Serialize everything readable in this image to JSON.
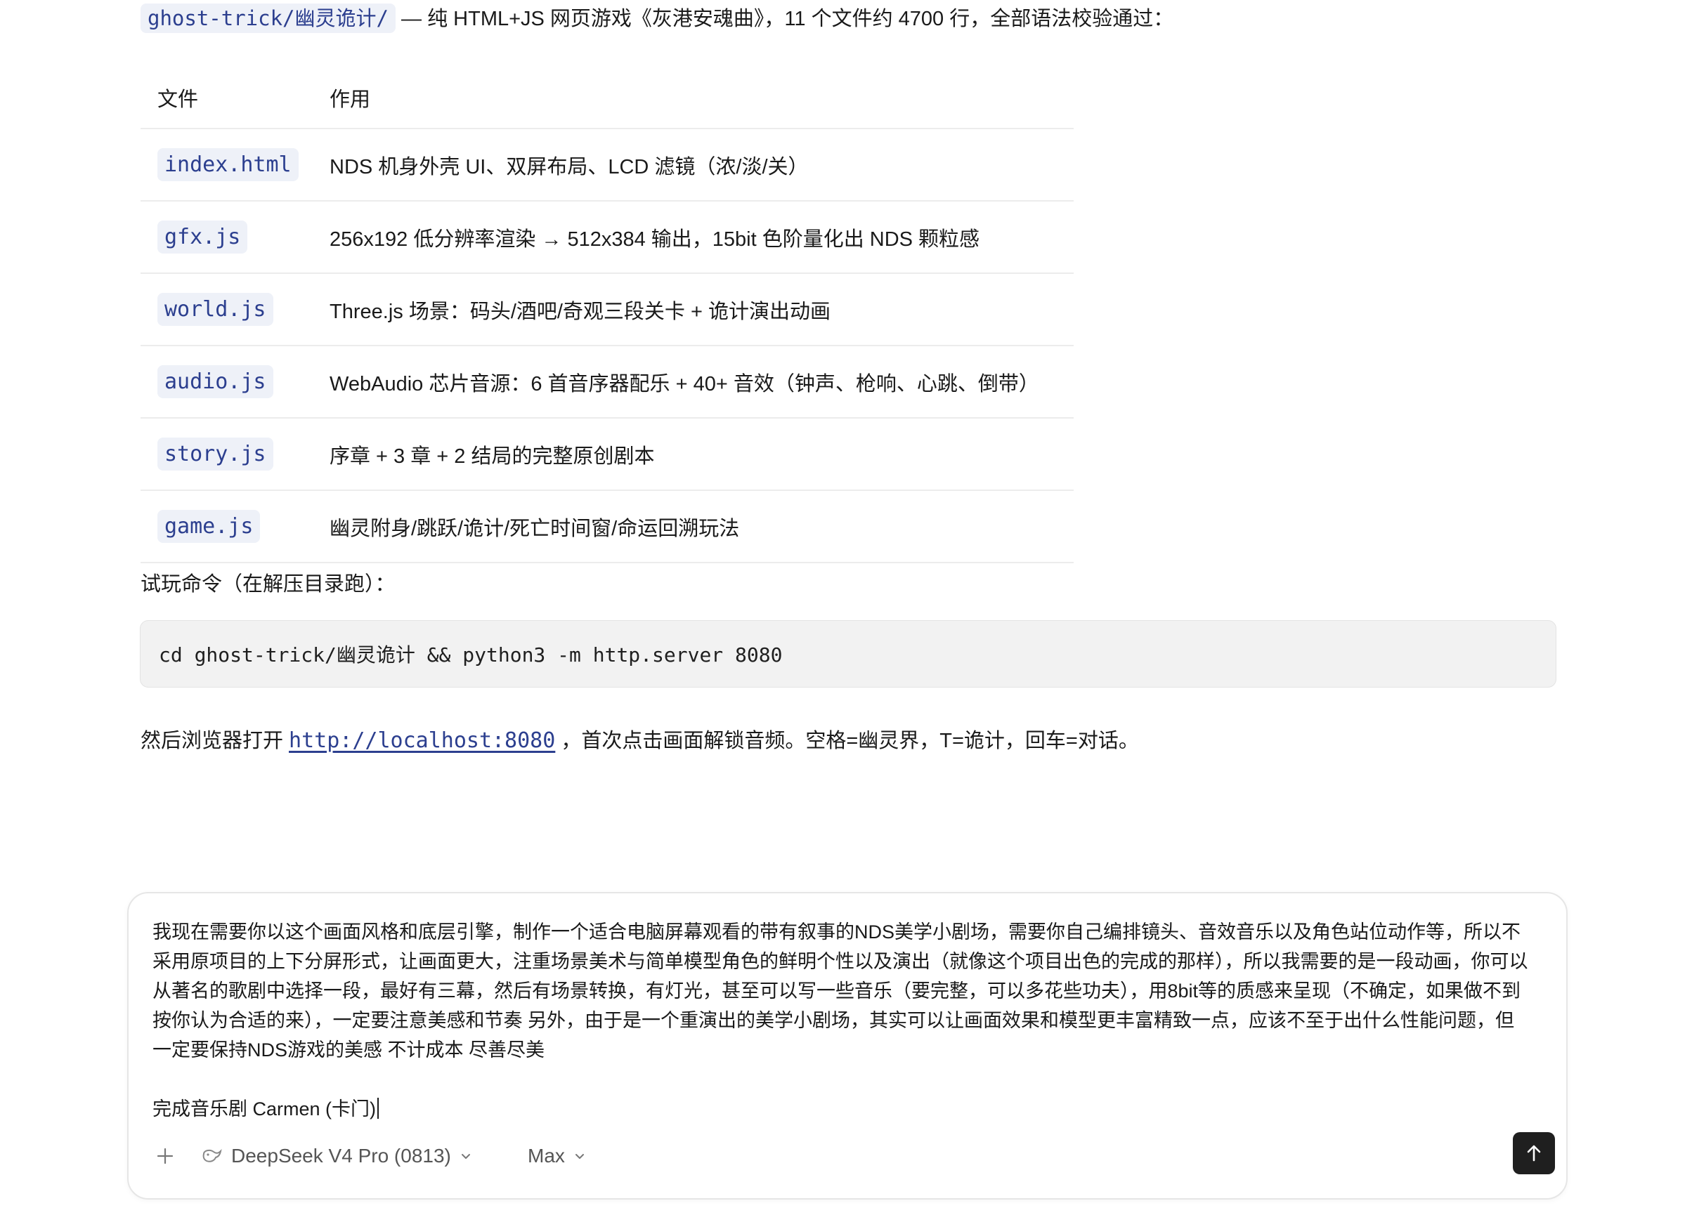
{
  "intro": {
    "path": "ghost-trick/幽灵诡计/",
    "text": " — 纯 HTML+JS 网页游戏《灰港安魂曲》，11 个文件约 4700 行，全部语法校验通过："
  },
  "file_table": {
    "headers": [
      "文件",
      "作用"
    ],
    "rows": [
      {
        "file": "index.html",
        "desc": "NDS 机身外壳 UI、双屏布局、LCD 滤镜（浓/淡/关）"
      },
      {
        "file": "gfx.js",
        "desc": "256x192 低分辨率渲染 → 512x384 输出，15bit 色阶量化出 NDS 颗粒感"
      },
      {
        "file": "world.js",
        "desc": "Three.js 场景：码头/酒吧/奇观三段关卡 + 诡计演出动画"
      },
      {
        "file": "audio.js",
        "desc": "WebAudio 芯片音源：6 首音序器配乐 + 40+ 音效（钟声、枪响、心跳、倒带）"
      },
      {
        "file": "story.js",
        "desc": "序章 + 3 章 + 2 结局的完整原创剧本"
      },
      {
        "file": "game.js",
        "desc": "幽灵附身/跳跃/诡计/死亡时间窗/命运回溯玩法"
      }
    ]
  },
  "try_label": "试玩命令（在解压目录跑）：",
  "code": "cd ghost-trick/幽灵诡计 && python3 -m http.server 8080",
  "after": {
    "prefix": "然后浏览器打开",
    "link": "http://localhost:8080",
    "suffix": "，首次点击画面解锁音频。空格=幽灵界，T=诡计，回车=对话。"
  },
  "composer": {
    "lines": [
      "我现在需要你以这个画面风格和底层引擎，制作一个适合电脑屏幕观看的带有叙事的NDS美学小剧场，需要你自己编排镜头、音效音乐以及角色站位动作等，所以不",
      "采用原项目的上下分屏形式，让画面更大，注重场景美术与简单模型角色的鲜明个性以及演出（就像这个项目出色的完成的那样），所以我需要的是一段动画，你可以",
      "从著名的歌剧中选择一段，最好有三幕，然后有场景转换，有灯光，甚至可以写一些音乐（要完整，可以多花些功夫），用8bit等的质感来呈现（不确定，如果做不到",
      "按你认为合适的来），一定要注意美感和节奏 另外，由于是一个重演出的美学小剧场，其实可以让画面效果和模型更丰富精致一点，应该不至于出什么性能问题，但",
      "一定要保持NDS游戏的美感 不计成本 尽善尽美"
    ],
    "last_line": "完成音乐剧 Carmen (卡门)",
    "model": "DeepSeek V4 Pro (0813)",
    "mode": "Max"
  },
  "icons": {
    "plus": "plus-icon",
    "model": "whale-icon",
    "chevron": "chevron-down-icon",
    "send": "arrow-up-icon"
  }
}
